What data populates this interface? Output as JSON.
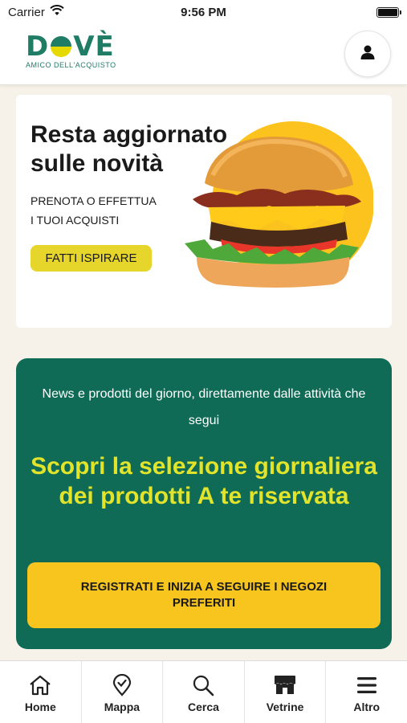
{
  "status_bar": {
    "carrier": "Carrier",
    "time": "9:56 PM"
  },
  "header": {
    "logo_text": "DOVE",
    "logo_tagline": "AMICO DELL'ACQUISTO",
    "profile_icon": "user-icon"
  },
  "promo": {
    "title": "Resta aggiornato sulle novità",
    "subtitle_line1": "PRENOTA O EFFETTUA",
    "subtitle_line2": "I TUOI ACQUISTI",
    "cta_label": "FATTI ISPIRARE"
  },
  "green_section": {
    "intro": "News e prodotti del giorno, direttamente dalle attività che segui",
    "headline": "Scopri la selezione giornaliera dei prodotti A te riservata",
    "register_label": "REGISTRATI E INIZIA A SEGUIRE I NEGOZI PREFERITI"
  },
  "tabs": [
    {
      "label": "Home",
      "icon": "home-icon"
    },
    {
      "label": "Mappa",
      "icon": "map-pin-icon"
    },
    {
      "label": "Cerca",
      "icon": "search-icon"
    },
    {
      "label": "Vetrine",
      "icon": "storefront-icon"
    },
    {
      "label": "Altro",
      "icon": "menu-icon"
    }
  ],
  "colors": {
    "brand_green": "#0f6b55",
    "brand_yellow": "#e1e42b",
    "button_yellow": "#f7c51d",
    "cta_yellow": "#e6d52a"
  }
}
